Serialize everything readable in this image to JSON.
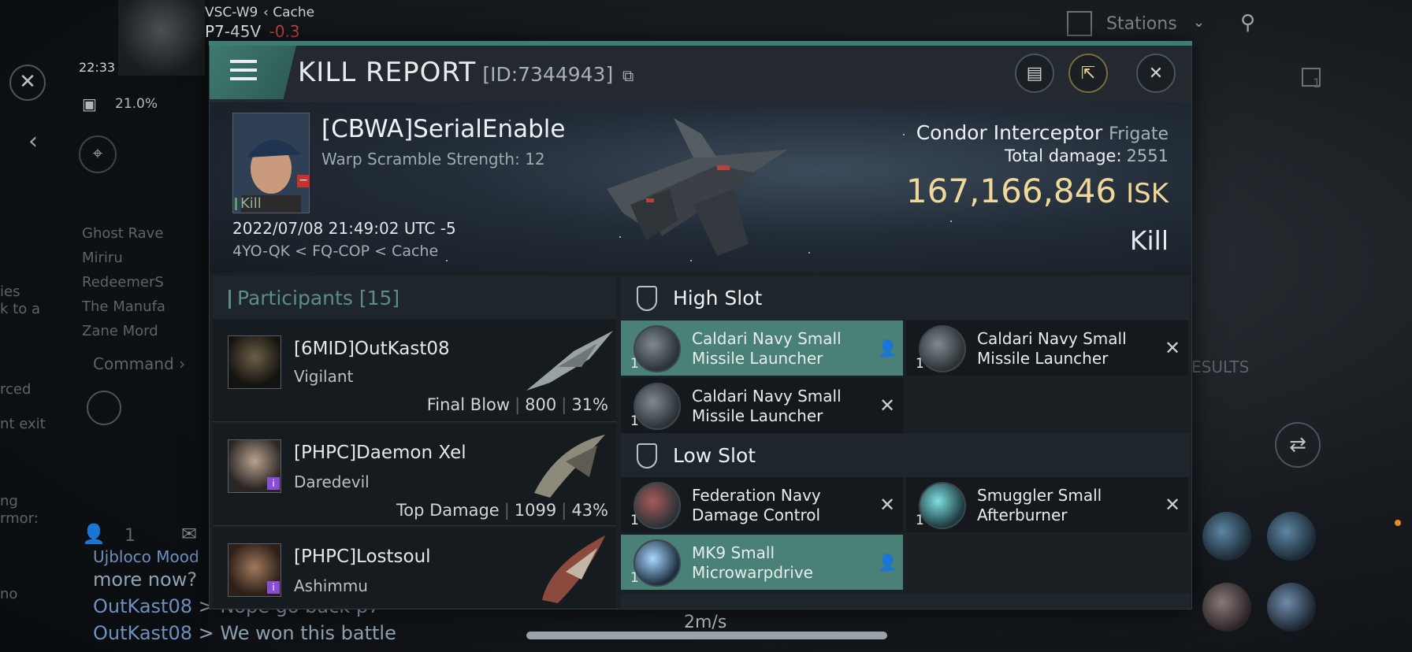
{
  "background": {
    "system": "VSC-W9",
    "back_label": "Cache",
    "location": "P7-45V",
    "security": "-0.3",
    "time": "22:33",
    "cargo_percent": "21.0%",
    "stations_label": "Stations",
    "right_count": "1",
    "left_list": [
      "Ghost Rave",
      "Miriru",
      "RedeemerS",
      "The Manufa",
      "Zane Mord"
    ],
    "command_label": "Command",
    "left_fragments": [
      "ies",
      "k to a",
      "rced",
      "nt exit",
      "ng",
      "rmor:",
      "no"
    ],
    "results_label": "ESULTS",
    "people_count": "1",
    "speed": "2m/s",
    "chat": [
      {
        "nick": "",
        "text": "more now?"
      },
      {
        "nick": "OutKast08",
        "text": " > Nope go back p7"
      },
      {
        "nick": "OutKast08",
        "text": " > We won this battle"
      }
    ],
    "chat_partial": "Ujbloco Mood"
  },
  "panel": {
    "title": "KILL REPORT",
    "report_id": "[ID:7344943]",
    "icons": [
      "menu-icon",
      "copy-icon",
      "clipboard-icon",
      "share-icon",
      "close-icon"
    ]
  },
  "victim": {
    "name": "[CBWA]SerialEnable",
    "subtitle": "Warp Scramble Strength: 12",
    "tag": "Kill",
    "datetime": "2022/07/08 21:49:02 UTC -5",
    "location": "4YO-QK < FQ-COP < Cache",
    "ship": "Condor Interceptor",
    "ship_class": "Frigate",
    "total_damage_label": "Total damage:",
    "total_damage": "2551",
    "isk_value": "167,166,846",
    "isk_unit": "ISK",
    "result": "Kill"
  },
  "participants": {
    "label": "Participants",
    "count": "[15]",
    "rows": [
      {
        "name": "[6MID]OutKast08",
        "ship": "Vigilant",
        "stat_label": "Final Blow",
        "damage": "800",
        "percent": "31%"
      },
      {
        "name": "[PHPC]Daemon Xel",
        "ship": "Daredevil",
        "stat_label": "Top Damage",
        "damage": "1099",
        "percent": "43%"
      },
      {
        "name": "[PHPC]Lostsoul",
        "ship": "Ashimmu"
      }
    ]
  },
  "slots": {
    "high": {
      "title": "High Slot",
      "items": [
        {
          "line1": "Caldari Navy Small",
          "line2": "Missile Launcher",
          "qty": "1"
        },
        {
          "line1": "Caldari Navy Small",
          "line2": "Missile Launcher",
          "qty": "1"
        },
        {
          "line1": "Caldari Navy Small",
          "line2": "Missile Launcher",
          "qty": "1"
        }
      ]
    },
    "low": {
      "title": "Low Slot",
      "items": [
        {
          "line1": "Federation Navy",
          "line2": "Damage Control",
          "qty": "1"
        },
        {
          "line1": "Smuggler Small",
          "line2": "Afterburner",
          "qty": "1"
        },
        {
          "line1": "MK9 Small",
          "line2": "Microwarpdrive",
          "qty": "1"
        }
      ]
    }
  },
  "colors": {
    "accent": "#4a8176",
    "isk": "#f0d79a",
    "panel": "#1b2025"
  }
}
